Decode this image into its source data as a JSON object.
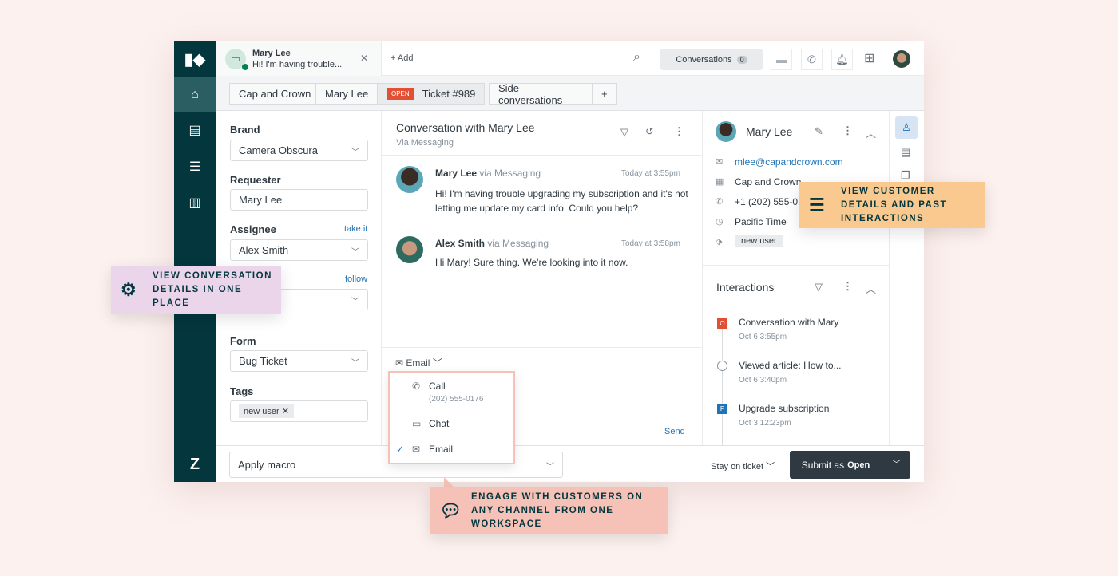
{
  "topbar": {
    "tab_name": "Mary Lee",
    "tab_preview": "Hi! I'm having trouble...",
    "add": "+ Add",
    "conversations": "Conversations",
    "conversations_count": "0"
  },
  "crumbs": {
    "org": "Cap and Crown",
    "user": "Mary Lee",
    "status": "OPEN",
    "ticket": "Ticket #989",
    "side": "Side conversations",
    "plus": "+"
  },
  "left": {
    "brand_label": "Brand",
    "brand": "Camera Obscura",
    "requester_label": "Requester",
    "requester": "Mary Lee",
    "assignee_label": "Assignee",
    "take_it": "take it",
    "assignee": "Alex Smith",
    "follow": "follow",
    "form_label": "Form",
    "form": "Bug Ticket",
    "tags_label": "Tags",
    "tag": "new user"
  },
  "conversation": {
    "title": "Conversation with Mary Lee",
    "via": "Via Messaging",
    "messages": [
      {
        "name": "Mary Lee",
        "via": "via Messaging",
        "time": "Today at 3:55pm",
        "text": "Hi! I'm having trouble upgrading my subscription and it's not letting me update my card info. Could you help?"
      },
      {
        "name": "Alex Smith",
        "via": "via Messaging",
        "time": "Today at 3:58pm",
        "text": "Hi Mary! Sure thing. We're looking into it now."
      }
    ],
    "channel": "Email",
    "send": "Send",
    "menu": {
      "call": "Call",
      "call_number": "(202) 555-0176",
      "chat": "Chat",
      "email": "Email"
    }
  },
  "customer": {
    "name": "Mary Lee",
    "email": "mlee@capandcrown.com",
    "org": "Cap and Crown",
    "phone": "+1 (202) 555-0176",
    "timezone": "Pacific Time",
    "tag": "new user"
  },
  "interactions": {
    "title": "Interactions",
    "items": [
      {
        "title": "Conversation with Mary",
        "time": "Oct 6 3:55pm",
        "badge": "O"
      },
      {
        "title": "Viewed article: How to...",
        "time": "Oct 6 3:40pm",
        "badge": ""
      },
      {
        "title": "Upgrade subscription",
        "time": "Oct 3 12:23pm",
        "badge": "P"
      }
    ]
  },
  "bottom": {
    "macro": "Apply macro",
    "stay": "Stay on ticket",
    "submit": "Submit as",
    "submit_status": "Open"
  },
  "callouts": {
    "conversation": "VIEW CONVERSATION DETAILS IN ONE PLACE",
    "customer": "VIEW CUSTOMER DETAILS AND PAST INTERACTIONS",
    "channel": "ENGAGE WITH CUSTOMERS ON ANY CHANNEL FROM ONE WORKSPACE"
  },
  "colors": {
    "nav": "#03363d",
    "open_badge": "#e34f32",
    "link": "#1f73b7",
    "submit": "#2f3941",
    "callout_purple": "#ead5ea",
    "callout_orange": "#f9c98f",
    "callout_pink": "#f6c2b8"
  }
}
